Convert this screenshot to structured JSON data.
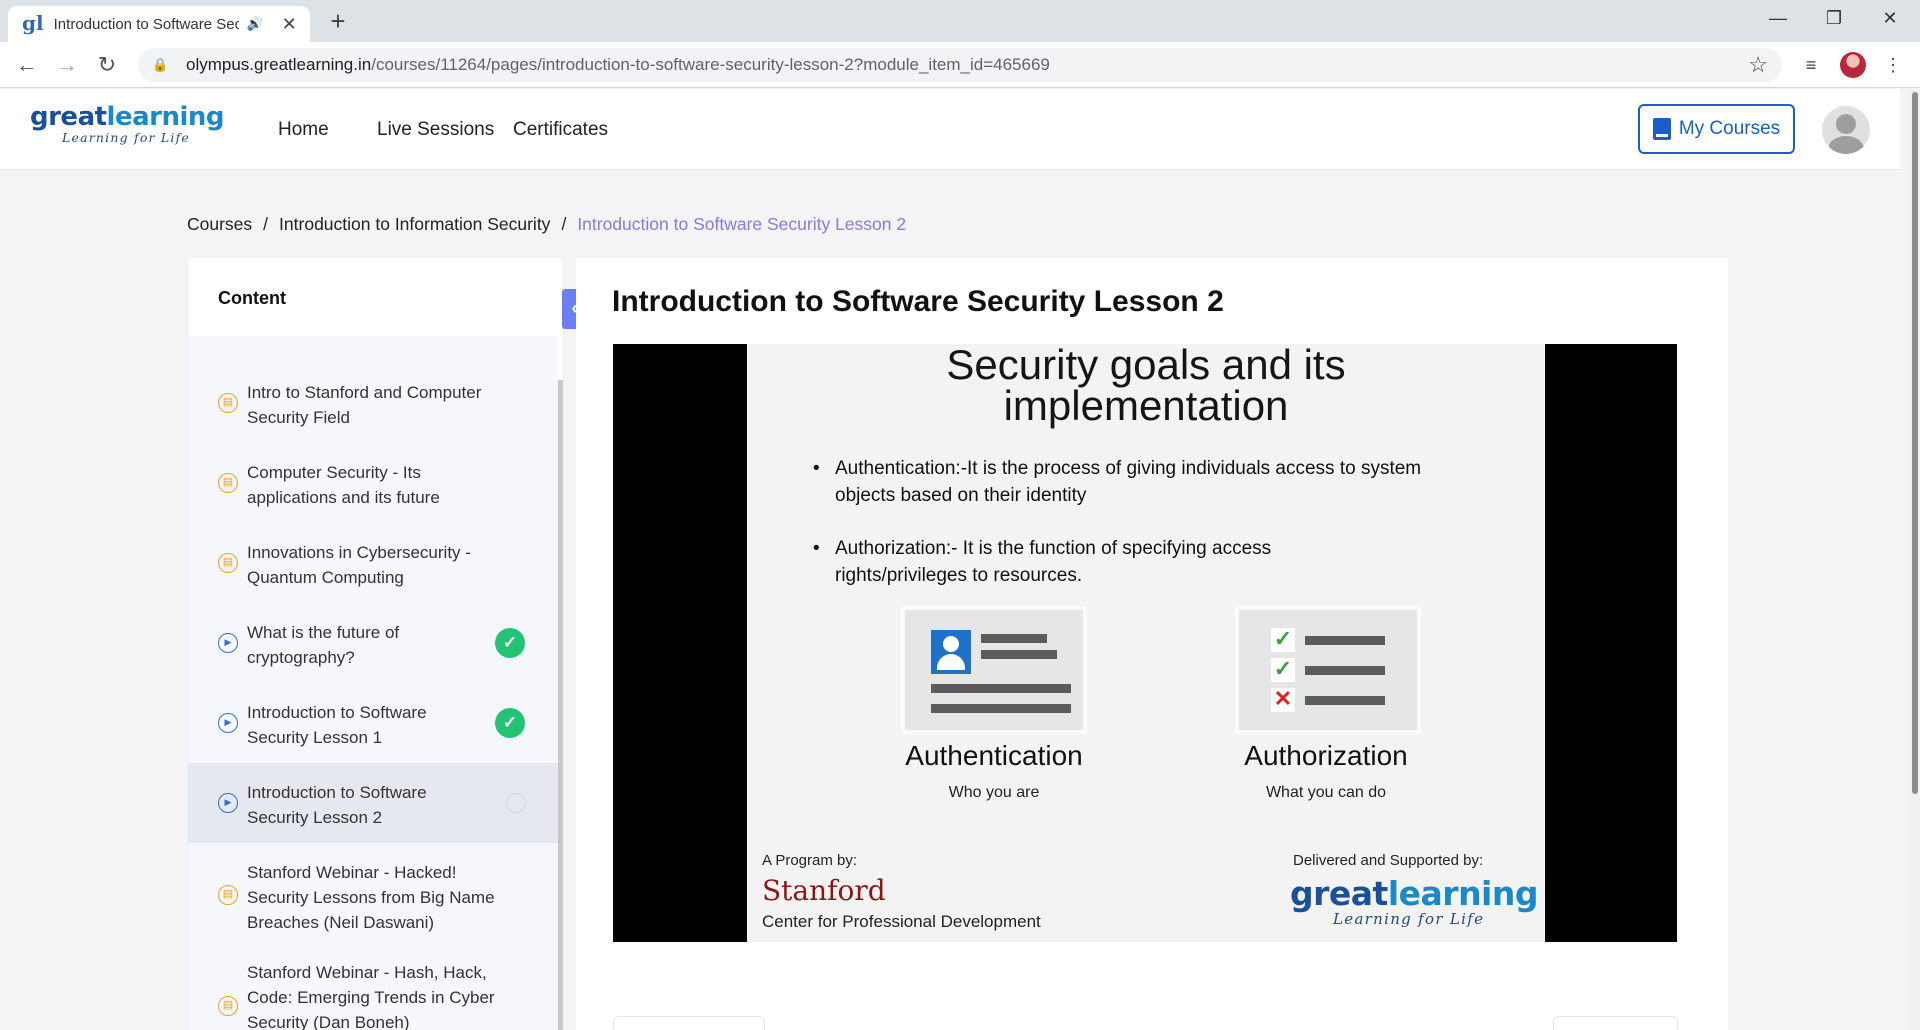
{
  "browser": {
    "tab_title": "Introduction to Software Sec",
    "url_host": "olympus.greatlearning.in",
    "url_path": "/courses/11264/pages/introduction-to-software-security-lesson-2?module_item_id=465669"
  },
  "site": {
    "logo_great": "great",
    "logo_learning": "learning",
    "logo_tagline": "Learning for Life",
    "nav": [
      "Home",
      "Live Sessions",
      "Certificates"
    ],
    "my_courses_label": "My Courses"
  },
  "breadcrumb": {
    "items": [
      "Courses",
      "Introduction to Information Security"
    ],
    "current": "Introduction to Software Security Lesson 2",
    "separator": "/"
  },
  "sidebar": {
    "heading": "Content",
    "items": [
      {
        "label": "Intro to Stanford and Computer Security Field",
        "type": "document",
        "status": "none"
      },
      {
        "label": "Computer Security - Its applications and its future",
        "type": "document",
        "status": "none"
      },
      {
        "label": "Innovations in Cybersecurity - Quantum Computing",
        "type": "document",
        "status": "none"
      },
      {
        "label": "What is the future of cryptography?",
        "type": "video",
        "status": "completed"
      },
      {
        "label": "Introduction to Software Security Lesson 1",
        "type": "video",
        "status": "completed"
      },
      {
        "label": "Introduction to Software Security Lesson 2",
        "type": "video",
        "status": "in-progress"
      },
      {
        "label": "Stanford Webinar - Hacked! Security Lessons from Big Name Breaches (Neil Daswani)",
        "type": "document",
        "status": "none"
      },
      {
        "label": "Stanford Webinar - Hash, Hack, Code: Emerging Trends in Cyber Security (Dan Boneh)",
        "type": "document",
        "status": "none"
      }
    ]
  },
  "lesson": {
    "title": "Introduction to Software Security Lesson 2"
  },
  "slide": {
    "title_line1": "Security goals and its",
    "title_line2": "implementation",
    "bullet1": "Authentication:-It is the process of giving individuals access to system objects based on their identity",
    "bullet2": "Authorization:- It is the function of specifying access rights/privileges to resources.",
    "auth_title": "Authentication",
    "auth_sub": "Who you are",
    "authz_title": "Authorization",
    "authz_sub": "What you can do",
    "program_by": "A Program by:",
    "stanford": "Stanford",
    "stanford_sub": "Center for Professional Development",
    "delivered_by": "Delivered and Supported by:",
    "gl_great": "great",
    "gl_learning": "learning",
    "gl_tagline": "Learning for Life"
  },
  "colors": {
    "brand_blue": "#1a5fc8",
    "breadcrumb_current": "#8a78e0",
    "completed_green": "#23c275",
    "collapse_button": "#6a7ff1"
  }
}
